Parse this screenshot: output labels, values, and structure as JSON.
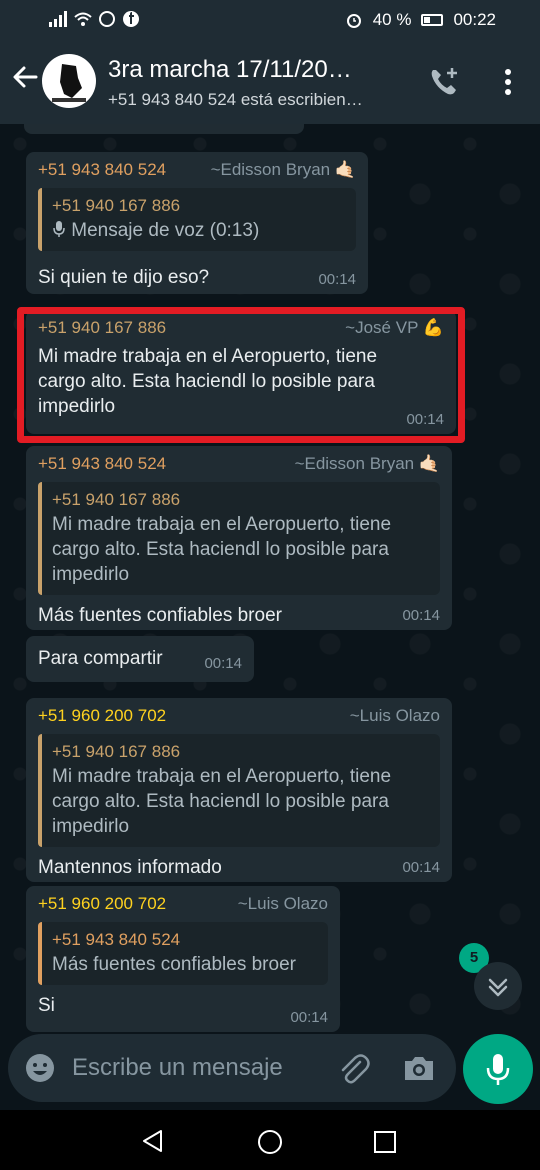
{
  "status_bar": {
    "battery": "40 %",
    "time": "00:22"
  },
  "header": {
    "title": "3ra marcha 17/11/20…",
    "subtitle": "+51 943 840 524 está escribien…"
  },
  "messages": [
    {
      "sender_number": "+51 943 840 524",
      "sender_name": "~Edisson Bryan 🤙🏻",
      "sender_color": "#e0a060",
      "quote": {
        "sender": "+51 940 167 886",
        "text": "Mensaje de voz (0:13)",
        "bar_color": "#c9a26b"
      },
      "text": "Si quien te dijo eso?",
      "time": "00:14"
    },
    {
      "sender_number": "+51 940 167 886",
      "sender_name": "~José VP 💪",
      "sender_color": "#c9a26b",
      "text": "Mi madre trabaja en el Aeropuerto, tiene cargo alto. Esta haciendl lo posible para impedirlo",
      "time": "00:14"
    },
    {
      "sender_number": "+51 943 840 524",
      "sender_name": "~Edisson Bryan 🤙🏻",
      "sender_color": "#e0a060",
      "quote": {
        "sender": "+51 940 167 886",
        "text": "Mi madre trabaja en el Aeropuerto, tiene cargo alto. Esta haciendl lo posible para impedirlo",
        "bar_color": "#c9a26b"
      },
      "text": "Más fuentes confiables broer",
      "time": "00:14"
    },
    {
      "text": "Para compartir",
      "time": "00:14"
    },
    {
      "sender_number": "+51 960 200 702",
      "sender_name": "~Luis Olazo",
      "sender_color": "#ffd21f",
      "quote": {
        "sender": "+51 940 167 886",
        "text": "Mi madre trabaja en el Aeropuerto, tiene cargo alto. Esta haciendl lo posible para impedirlo",
        "bar_color": "#c9a26b"
      },
      "text": "Mantennos informado",
      "time": "00:14"
    },
    {
      "sender_number": "+51 960 200 702",
      "sender_name": "~Luis Olazo",
      "sender_color": "#ffd21f",
      "quote": {
        "sender": "+51 943 840 524",
        "text": "Más fuentes confiables broer",
        "bar_color": "#e0a060"
      },
      "text": "Si",
      "time": "00:14"
    }
  ],
  "unread_badge": "5",
  "composer": {
    "placeholder": "Escribe un mensaje"
  },
  "colors": {
    "accent": "#00a884",
    "highlight": "#e31c24",
    "bubble": "#202c33"
  }
}
